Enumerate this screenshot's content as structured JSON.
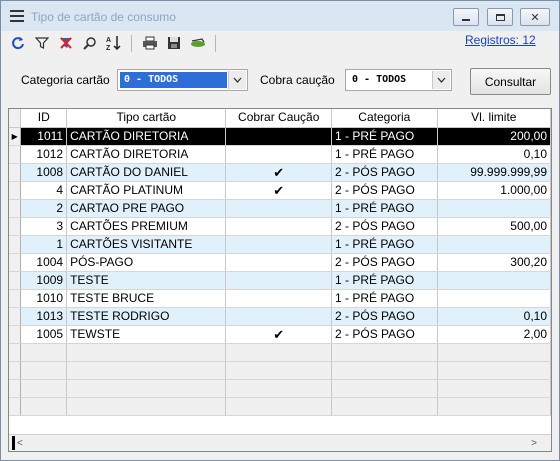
{
  "window": {
    "title": "Tipo de cartão de consumo"
  },
  "toolbar": {
    "registros": "Registros: 12",
    "icons": [
      "refresh-icon",
      "filter-icon",
      "clear-filter-icon",
      "search-icon",
      "sort-icon",
      "print-icon",
      "save-icon",
      "export-icon"
    ]
  },
  "filters": {
    "categoria_label": "Categoria cartão",
    "categoria_value": "0  -  TODOS",
    "caucao_label": "Cobra caução",
    "caucao_value": "0  -  TODOS",
    "consultar_label": "Consultar"
  },
  "grid": {
    "columns": [
      "ID",
      "Tipo cartão",
      "Cobrar Caução",
      "Categoria",
      "Vl. limite"
    ],
    "rows": [
      {
        "id": "1011",
        "tipo": "CARTÃO DIRETORIA",
        "caucao": "",
        "categoria": "1 - PRÉ PAGO",
        "limite": "200,00"
      },
      {
        "id": "1012",
        "tipo": "CARTÃO DIRETORIA",
        "caucao": "",
        "categoria": "1 - PRÉ PAGO",
        "limite": "0,10"
      },
      {
        "id": "1008",
        "tipo": "CARTÃO DO DANIEL",
        "caucao": "✔",
        "categoria": "2 - PÓS PAGO",
        "limite": "99.999.999,99"
      },
      {
        "id": "4",
        "tipo": "CARTÃO PLATINUM",
        "caucao": "✔",
        "categoria": "2 - PÓS PAGO",
        "limite": "1.000,00"
      },
      {
        "id": "2",
        "tipo": "CARTAO PRE PAGO",
        "caucao": "",
        "categoria": "1 - PRÉ PAGO",
        "limite": ""
      },
      {
        "id": "3",
        "tipo": "CARTÕES PREMIUM",
        "caucao": "",
        "categoria": "2 - PÓS PAGO",
        "limite": "500,00"
      },
      {
        "id": "1",
        "tipo": "CARTÕES VISITANTE",
        "caucao": "",
        "categoria": "1 - PRÉ PAGO",
        "limite": ""
      },
      {
        "id": "1004",
        "tipo": "PÓS-PAGO",
        "caucao": "",
        "categoria": "2 - PÓS PAGO",
        "limite": "300,20"
      },
      {
        "id": "1009",
        "tipo": "TESTE",
        "caucao": "",
        "categoria": "1 - PRÉ PAGO",
        "limite": ""
      },
      {
        "id": "1010",
        "tipo": "TESTE BRUCE",
        "caucao": "",
        "categoria": "1 - PRÉ PAGO",
        "limite": ""
      },
      {
        "id": "1013",
        "tipo": "TESTE RODRIGO",
        "caucao": "",
        "categoria": "2 - PÓS PAGO",
        "limite": "0,10"
      },
      {
        "id": "1005",
        "tipo": "TEWSTE",
        "caucao": "✔",
        "categoria": "2 - PÓS PAGO",
        "limite": "2,00"
      }
    ],
    "selected_row": 0
  },
  "colors": {
    "selected_row_bg": "#000000",
    "alt_row_bg": "#e1f1fb",
    "link": "#1a3fc9",
    "combo_highlight": "#2e6ed9"
  }
}
